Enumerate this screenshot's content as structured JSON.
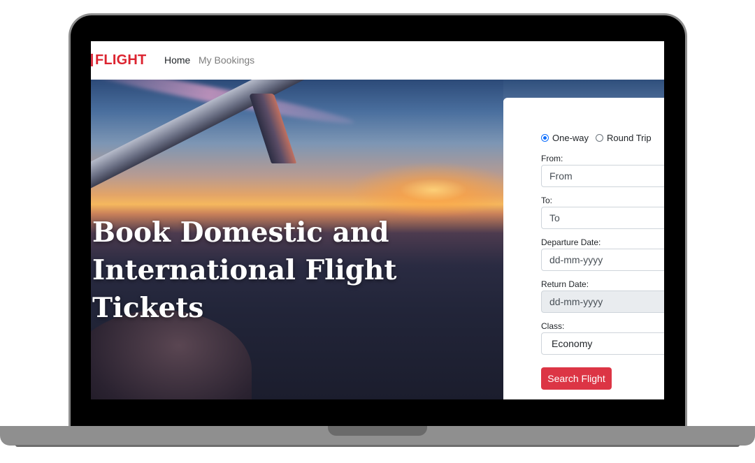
{
  "navbar": {
    "brand": "FLIGHT",
    "links": [
      {
        "label": "Home"
      },
      {
        "label": "My Bookings"
      }
    ]
  },
  "hero": {
    "title": "Book Domestic and\nInternational Flight\nTickets"
  },
  "search_form": {
    "trip_types": [
      {
        "label": "One-way",
        "checked": true
      },
      {
        "label": "Round Trip",
        "checked": false
      }
    ],
    "from": {
      "label": "From:",
      "placeholder": "From"
    },
    "to": {
      "label": "To:",
      "placeholder": "To"
    },
    "departure": {
      "label": "Departure Date:",
      "value": "dd-mm-yyyy"
    },
    "return": {
      "label": "Return Date:",
      "value": "dd-mm-yyyy",
      "disabled": true
    },
    "class": {
      "label": "Class:",
      "selected": "Economy"
    },
    "submit_label": "Search Flight"
  },
  "colors": {
    "brand_red": "#dc3545",
    "radio_blue": "#0d6efd"
  }
}
